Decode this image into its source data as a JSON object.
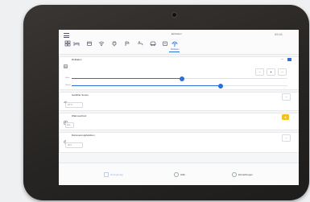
{
  "app": {
    "title": "Einheiten",
    "time": "09:41"
  },
  "toolbar": {
    "active_label": "Rollladen",
    "tools": [
      {
        "icon": "grid-icon"
      },
      {
        "icon": "bed-icon"
      },
      {
        "icon": "box-icon"
      },
      {
        "icon": "wifi-icon"
      },
      {
        "icon": "plug-icon"
      },
      {
        "icon": "shower-icon"
      },
      {
        "icon": "faucet-icon"
      },
      {
        "icon": "car-icon"
      },
      {
        "icon": "box-icon"
      },
      {
        "icon": "umbrella-icon"
      }
    ]
  },
  "rollladen": {
    "title": "Rollladen",
    "slider1": {
      "label": "Höhe",
      "value_fraction": 0.51
    },
    "slider2": {
      "label": "Winkel",
      "value_fraction": 0.69
    }
  },
  "row1": {
    "title": "Gefühlte Sonne",
    "value": "18 °C"
  },
  "row2": {
    "title": "Wärmeschutz",
    "value": "Aus"
  },
  "row3": {
    "title": "Dämmerungsfunktion",
    "value": "20 lx"
  },
  "bottom": {
    "hint": "Rückgängig",
    "help": "Hilfe",
    "settings": "Einstellungen"
  },
  "colors": {
    "accent": "#2b6fd8",
    "warning": "#f1c21b",
    "bezel": "#2a2725"
  }
}
